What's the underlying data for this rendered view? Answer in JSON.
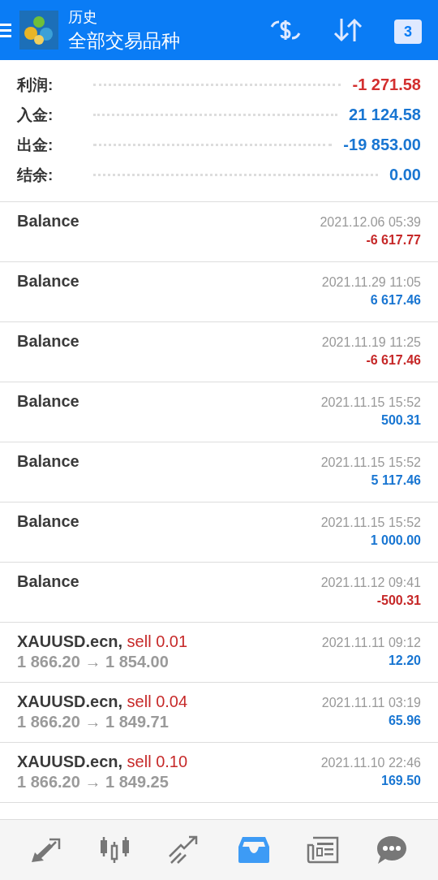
{
  "header": {
    "title": "历史",
    "subtitle": "全部交易品种",
    "actions": [
      {
        "kind": "dollar-cycle"
      },
      {
        "kind": "sort"
      },
      {
        "kind": "calendar",
        "label": "3"
      }
    ]
  },
  "summary": [
    {
      "label": "利润:",
      "value": "-1 271.58",
      "color": "#d32f2f"
    },
    {
      "label": "入金:",
      "value": "21 124.58",
      "color": "#1976d2"
    },
    {
      "label": "出金:",
      "value": "-19 853.00",
      "color": "#1976d2"
    },
    {
      "label": "结余:",
      "value": "0.00",
      "color": "#1976d2"
    }
  ],
  "entries": [
    {
      "kind": "balance",
      "title": "Balance",
      "time": "2021.12.06 05:39",
      "amount": "-6 617.77",
      "negative": true
    },
    {
      "kind": "balance",
      "title": "Balance",
      "time": "2021.11.29 11:05",
      "amount": "6 617.46",
      "negative": false
    },
    {
      "kind": "balance",
      "title": "Balance",
      "time": "2021.11.19 11:25",
      "amount": "-6 617.46",
      "negative": true
    },
    {
      "kind": "balance",
      "title": "Balance",
      "time": "2021.11.15 15:52",
      "amount": "500.31",
      "negative": false
    },
    {
      "kind": "balance",
      "title": "Balance",
      "time": "2021.11.15 15:52",
      "amount": "5 117.46",
      "negative": false
    },
    {
      "kind": "balance",
      "title": "Balance",
      "time": "2021.11.15 15:52",
      "amount": "1 000.00",
      "negative": false
    },
    {
      "kind": "balance",
      "title": "Balance",
      "time": "2021.11.12 09:41",
      "amount": "-500.31",
      "negative": true
    },
    {
      "kind": "deal",
      "title": "XAUUSD.ecn,",
      "type": "sell 0.01",
      "prices": "1 866.20 → 1 854.00",
      "time": "2021.11.11 09:12",
      "amount": "12.20",
      "negative": false
    },
    {
      "kind": "deal",
      "title": "XAUUSD.ecn,",
      "type": "sell 0.04",
      "prices": "1 866.20 → 1 849.71",
      "time": "2021.11.11 03:19",
      "amount": "65.96",
      "negative": false
    },
    {
      "kind": "deal",
      "title": "XAUUSD.ecn,",
      "type": "sell 0.10",
      "prices": "1 866.20 → 1 849.25",
      "time": "2021.11.10 22:46",
      "amount": "169.50",
      "negative": false
    }
  ],
  "nav": [
    {
      "kind": "quotes",
      "selected": false
    },
    {
      "kind": "chart",
      "selected": false
    },
    {
      "kind": "trade",
      "selected": false
    },
    {
      "kind": "history",
      "selected": true
    },
    {
      "kind": "news",
      "selected": false
    },
    {
      "kind": "chat",
      "selected": false
    }
  ]
}
